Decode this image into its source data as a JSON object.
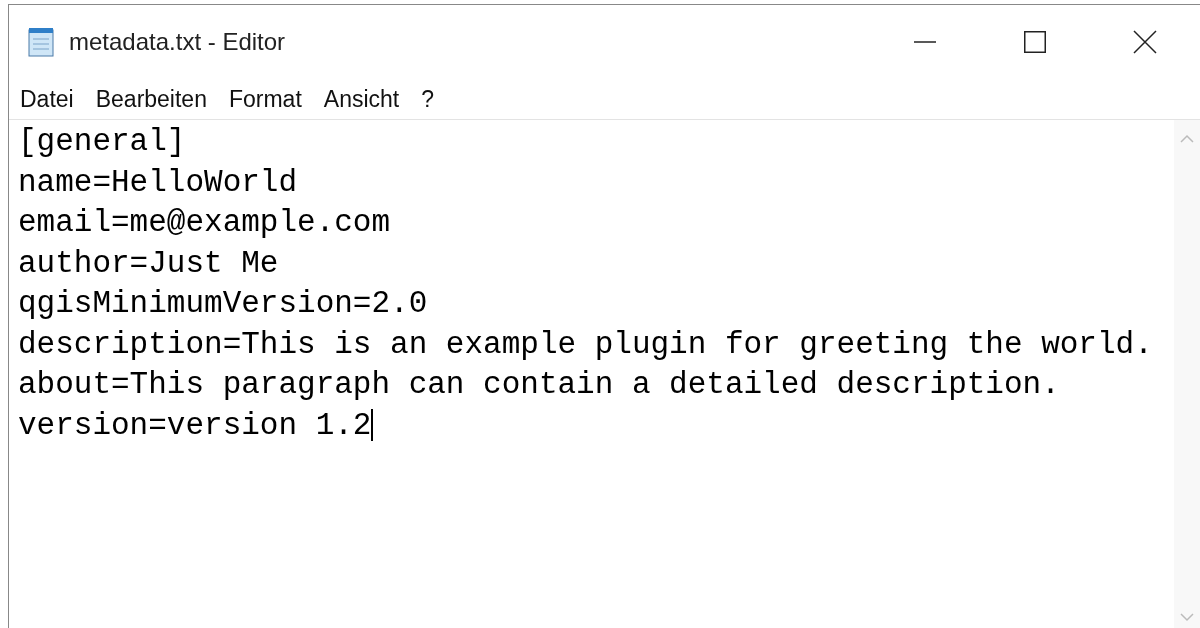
{
  "window": {
    "title": "metadata.txt - Editor"
  },
  "menu": [
    "Datei",
    "Bearbeiten",
    "Format",
    "Ansicht",
    "?"
  ],
  "editor": {
    "lines": [
      "[general]",
      "name=HelloWorld",
      "email=me@example.com",
      "author=Just Me",
      "qgisMinimumVersion=2.0",
      "description=This is an example plugin for greeting the world.",
      "about=This paragraph can contain a detailed description.",
      "version=version 1.2"
    ]
  }
}
